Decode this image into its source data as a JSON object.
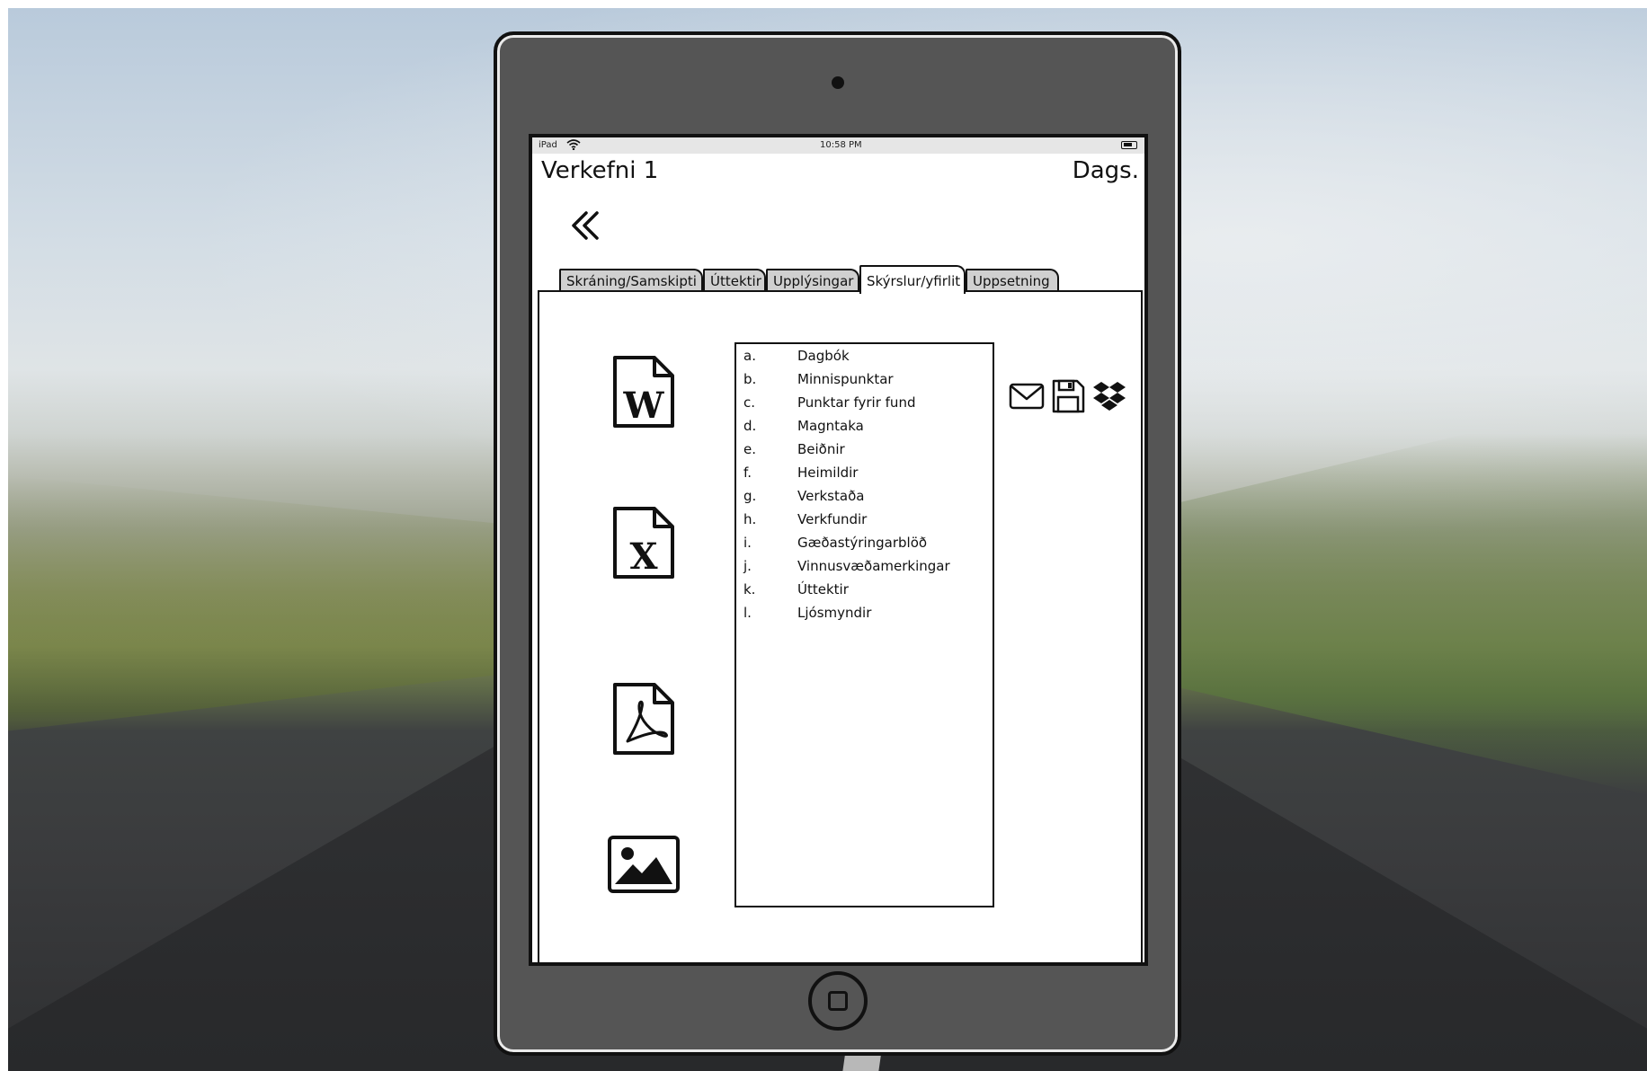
{
  "status_bar": {
    "carrier": "iPad",
    "time": "10:58 PM"
  },
  "header": {
    "title": "Verkefni 1",
    "date_label": "Dags."
  },
  "tabs": [
    {
      "label": "Skráning/Samskipti",
      "active": false
    },
    {
      "label": "Úttektir",
      "active": false
    },
    {
      "label": "Upplýsingar",
      "active": false
    },
    {
      "label": "Skýrslur/yfirlit",
      "active": true
    },
    {
      "label": "Uppsetning",
      "active": false
    }
  ],
  "file_types": [
    {
      "icon": "word-document-icon"
    },
    {
      "icon": "excel-document-icon"
    },
    {
      "icon": "pdf-document-icon"
    },
    {
      "icon": "image-icon"
    }
  ],
  "reports": [
    {
      "letter": "a.",
      "name": "Dagbók"
    },
    {
      "letter": "b.",
      "name": "Minnispunktar"
    },
    {
      "letter": "c.",
      "name": "Punktar fyrir fund"
    },
    {
      "letter": "d.",
      "name": "Magntaka"
    },
    {
      "letter": "e.",
      "name": "Beiðnir"
    },
    {
      "letter": "f.",
      "name": "Heimildir"
    },
    {
      "letter": "g.",
      "name": "Verkstaða"
    },
    {
      "letter": "h.",
      "name": "Verkfundir"
    },
    {
      "letter": "i.",
      "name": "Gæðastýringarblöð"
    },
    {
      "letter": "j.",
      "name": "Vinnusvæðamerkingar"
    },
    {
      "letter": "k.",
      "name": "Úttektir"
    },
    {
      "letter": "l.",
      "name": "Ljósmyndir"
    }
  ],
  "actions": [
    {
      "icon": "email-icon"
    },
    {
      "icon": "save-icon"
    },
    {
      "icon": "dropbox-icon"
    }
  ]
}
